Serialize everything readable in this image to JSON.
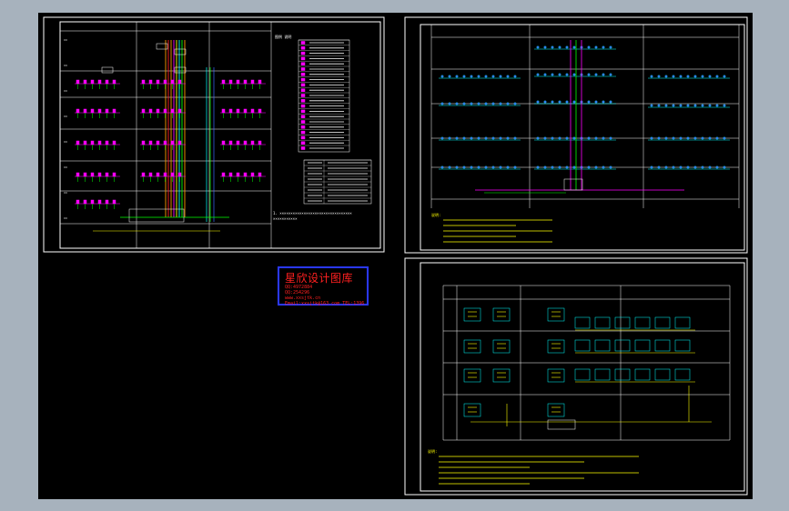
{
  "stamp": {
    "title": "星欣设计图库",
    "lines": [
      "QQ:4972884",
      "QQ:254296",
      "www.xxsjtk.cn",
      "Email:xxsjtk@163.com  TEL:1396"
    ]
  },
  "sheet1": {
    "legend_heading": "图例  说明",
    "note_text": "1. ×××××××××××××××××××××××××××××××××",
    "note_text2": "   ×××××××××××"
  },
  "sheet2": {
    "note_label": "说明:"
  },
  "sheet3": {
    "note_label": "说明:"
  },
  "colors": {
    "canvas": "#a7b2bd",
    "viewport": "#000000",
    "frame": "#ffffff",
    "magenta": "#ff00ff",
    "green": "#00ff00",
    "yellow": "#ffff00",
    "cyan": "#00ffff",
    "orange": "#ff9a00",
    "blue": "#3a6bff",
    "red": "#ff2020"
  }
}
